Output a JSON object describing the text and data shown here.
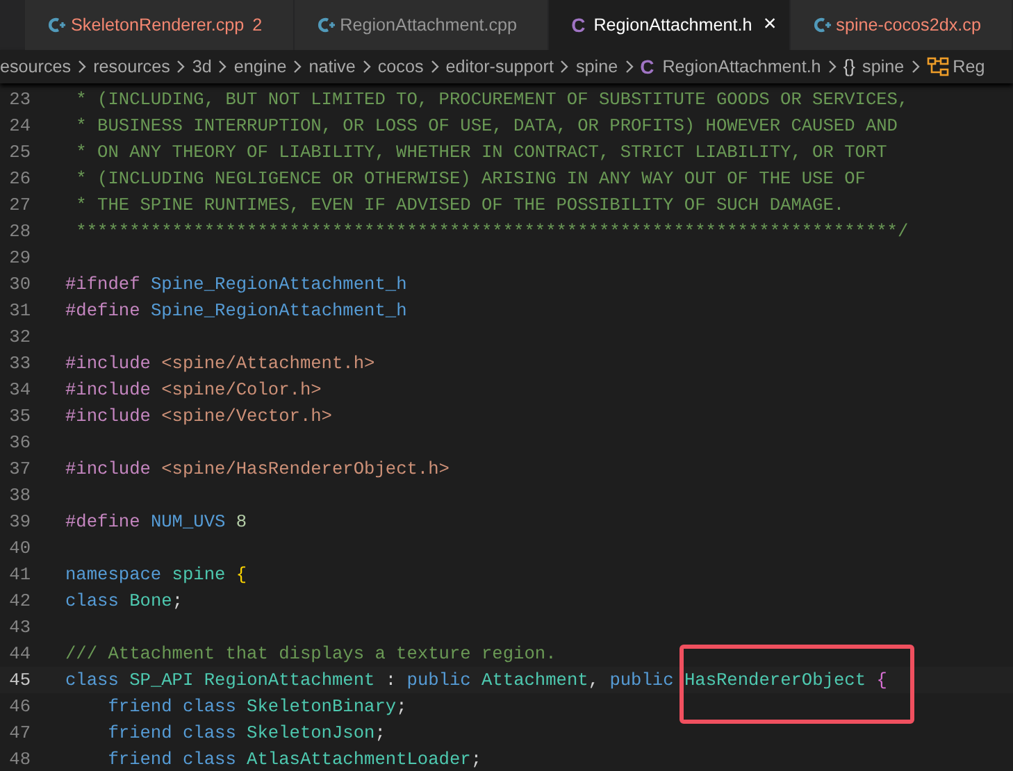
{
  "tabs": [
    {
      "kind": "cpp",
      "label": "SkeletonRenderer.cpp",
      "problems": "2",
      "error": true,
      "selected": false
    },
    {
      "kind": "cpp",
      "label": "RegionAttachment.cpp",
      "error": false,
      "selected": false
    },
    {
      "kind": "header",
      "icon_text": "C",
      "label": "RegionAttachment.h",
      "error": false,
      "selected": true,
      "close": "×"
    },
    {
      "kind": "cpp",
      "label": "spine-cocos2dx.cp",
      "error": true,
      "selected": false
    }
  ],
  "breadcrumb": [
    {
      "label": "esources"
    },
    {
      "label": "resources"
    },
    {
      "label": "3d"
    },
    {
      "label": "engine"
    },
    {
      "label": "native"
    },
    {
      "label": "cocos"
    },
    {
      "label": "editor-support"
    },
    {
      "label": "spine"
    },
    {
      "kind": "header",
      "icon_text": "C",
      "label": "RegionAttachment.h"
    },
    {
      "kind": "namespace",
      "icon_text": "{}",
      "label": "spine"
    },
    {
      "kind": "class",
      "label": "Reg"
    }
  ],
  "editor": {
    "lines": [
      {
        "number": "23",
        "current": false,
        "tokens": [
          {
            "kind": "comment",
            "text": " * (INCLUDING, BUT NOT LIMITED TO, PROCUREMENT OF SUBSTITUTE GOODS OR SERVICES,"
          }
        ]
      },
      {
        "number": "24",
        "current": false,
        "tokens": [
          {
            "kind": "comment",
            "text": " * BUSINESS INTERRUPTION, OR LOSS OF USE, DATA, OR PROFITS) HOWEVER CAUSED AND"
          }
        ]
      },
      {
        "number": "25",
        "current": false,
        "tokens": [
          {
            "kind": "comment",
            "text": " * ON ANY THEORY OF LIABILITY, WHETHER IN CONTRACT, STRICT LIABILITY, OR TORT"
          }
        ]
      },
      {
        "number": "26",
        "current": false,
        "tokens": [
          {
            "kind": "comment",
            "text": " * (INCLUDING NEGLIGENCE OR OTHERWISE) ARISING IN ANY WAY OUT OF THE USE OF"
          }
        ]
      },
      {
        "number": "27",
        "current": false,
        "tokens": [
          {
            "kind": "comment",
            "text": " * THE SPINE RUNTIMES, EVEN IF ADVISED OF THE POSSIBILITY OF SUCH DAMAGE."
          }
        ]
      },
      {
        "number": "28",
        "current": false,
        "tokens": [
          {
            "kind": "comment",
            "text": " *****************************************************************************/"
          }
        ]
      },
      {
        "number": "29",
        "current": false
      },
      {
        "number": "30",
        "current": false,
        "tokens": [
          {
            "kind": "directive",
            "text": "#ifndef"
          },
          {
            "kind": "macro",
            "text": " Spine_RegionAttachment_h"
          }
        ]
      },
      {
        "number": "31",
        "current": false,
        "tokens": [
          {
            "kind": "directive",
            "text": "#define"
          },
          {
            "kind": "macro",
            "text": " Spine_RegionAttachment_h"
          }
        ]
      },
      {
        "number": "32",
        "current": false
      },
      {
        "number": "33",
        "current": false,
        "tokens": [
          {
            "kind": "directive",
            "text": "#include"
          },
          {
            "kind": "string",
            "text": " <spine/Attachment.h>"
          }
        ]
      },
      {
        "number": "34",
        "current": false,
        "tokens": [
          {
            "kind": "directive",
            "text": "#include"
          },
          {
            "kind": "string",
            "text": " <spine/Color.h>"
          }
        ]
      },
      {
        "number": "35",
        "current": false,
        "tokens": [
          {
            "kind": "directive",
            "text": "#include"
          },
          {
            "kind": "string",
            "text": " <spine/Vector.h>"
          }
        ]
      },
      {
        "number": "36",
        "current": false
      },
      {
        "number": "37",
        "current": false,
        "tokens": [
          {
            "kind": "directive",
            "text": "#include"
          },
          {
            "kind": "string",
            "text": " <spine/HasRendererObject.h>"
          }
        ]
      },
      {
        "number": "38",
        "current": false
      },
      {
        "number": "39",
        "current": false,
        "tokens": [
          {
            "kind": "directive",
            "text": "#define"
          },
          {
            "kind": "macro",
            "text": " NUM_UVS"
          },
          {
            "kind": "number",
            "text": " 8"
          }
        ]
      },
      {
        "number": "40",
        "current": false
      },
      {
        "number": "41",
        "current": false,
        "tokens": [
          {
            "kind": "keyword",
            "text": "namespace"
          },
          {
            "kind": "type",
            "text": " spine"
          },
          {
            "kind": "bracket",
            "text": " {"
          }
        ]
      },
      {
        "number": "42",
        "current": false,
        "tokens": [
          {
            "kind": "keyword",
            "text": "class"
          },
          {
            "kind": "type",
            "text": " Bone"
          },
          {
            "kind": "plain",
            "text": ";"
          }
        ]
      },
      {
        "number": "43",
        "current": false
      },
      {
        "number": "44",
        "current": false,
        "tokens": [
          {
            "kind": "comment",
            "text": "/// Attachment that displays a texture region."
          }
        ]
      },
      {
        "number": "45",
        "current": true,
        "tokens": [
          {
            "kind": "keyword",
            "text": "class"
          },
          {
            "kind": "type",
            "text": " SP_API"
          },
          {
            "kind": "type",
            "text": " RegionAttachment"
          },
          {
            "kind": "plain",
            "text": " : "
          },
          {
            "kind": "keyword",
            "text": "public"
          },
          {
            "kind": "type",
            "text": " Attachment"
          },
          {
            "kind": "plain",
            "text": ", "
          },
          {
            "kind": "keyword",
            "text": "public"
          },
          {
            "kind": "type",
            "text": " HasRendererObject"
          },
          {
            "kind": "bracket2",
            "text": " {"
          }
        ]
      },
      {
        "number": "46",
        "current": false,
        "tokens": [
          {
            "kind": "keyword",
            "text": "    friend"
          },
          {
            "kind": "keyword",
            "text": " class"
          },
          {
            "kind": "type",
            "text": " SkeletonBinary"
          },
          {
            "kind": "plain",
            "text": ";"
          }
        ]
      },
      {
        "number": "47",
        "current": false,
        "tokens": [
          {
            "kind": "keyword",
            "text": "    friend"
          },
          {
            "kind": "keyword",
            "text": " class"
          },
          {
            "kind": "type",
            "text": " SkeletonJson"
          },
          {
            "kind": "plain",
            "text": ";"
          }
        ]
      },
      {
        "number": "48",
        "current": false,
        "tokens": [
          {
            "kind": "keyword",
            "text": "    friend"
          },
          {
            "kind": "keyword",
            "text": " class"
          },
          {
            "kind": "type",
            "text": " AtlasAttachmentLoader"
          },
          {
            "kind": "plain",
            "text": ";"
          }
        ]
      }
    ]
  }
}
